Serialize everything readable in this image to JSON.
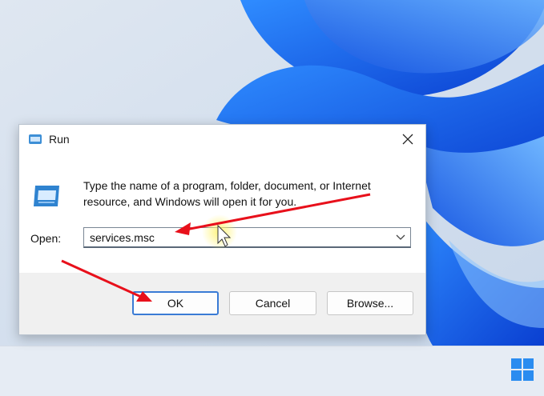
{
  "dialog": {
    "title": "Run",
    "description": "Type the name of a program, folder, document, or Internet resource, and Windows will open it for you.",
    "open_label": "Open:",
    "open_value": "services.msc",
    "buttons": {
      "ok": "OK",
      "cancel": "Cancel",
      "browse": "Browse..."
    }
  },
  "icons": {
    "title": "run-icon",
    "body": "run-icon",
    "close": "close-icon",
    "dropdown": "chevron-down-icon",
    "start": "windows-logo-icon"
  },
  "colors": {
    "accent": "#3a7bd5",
    "annotation_arrow": "#e8101b",
    "wallpaper_blue": "#1e6fff"
  }
}
